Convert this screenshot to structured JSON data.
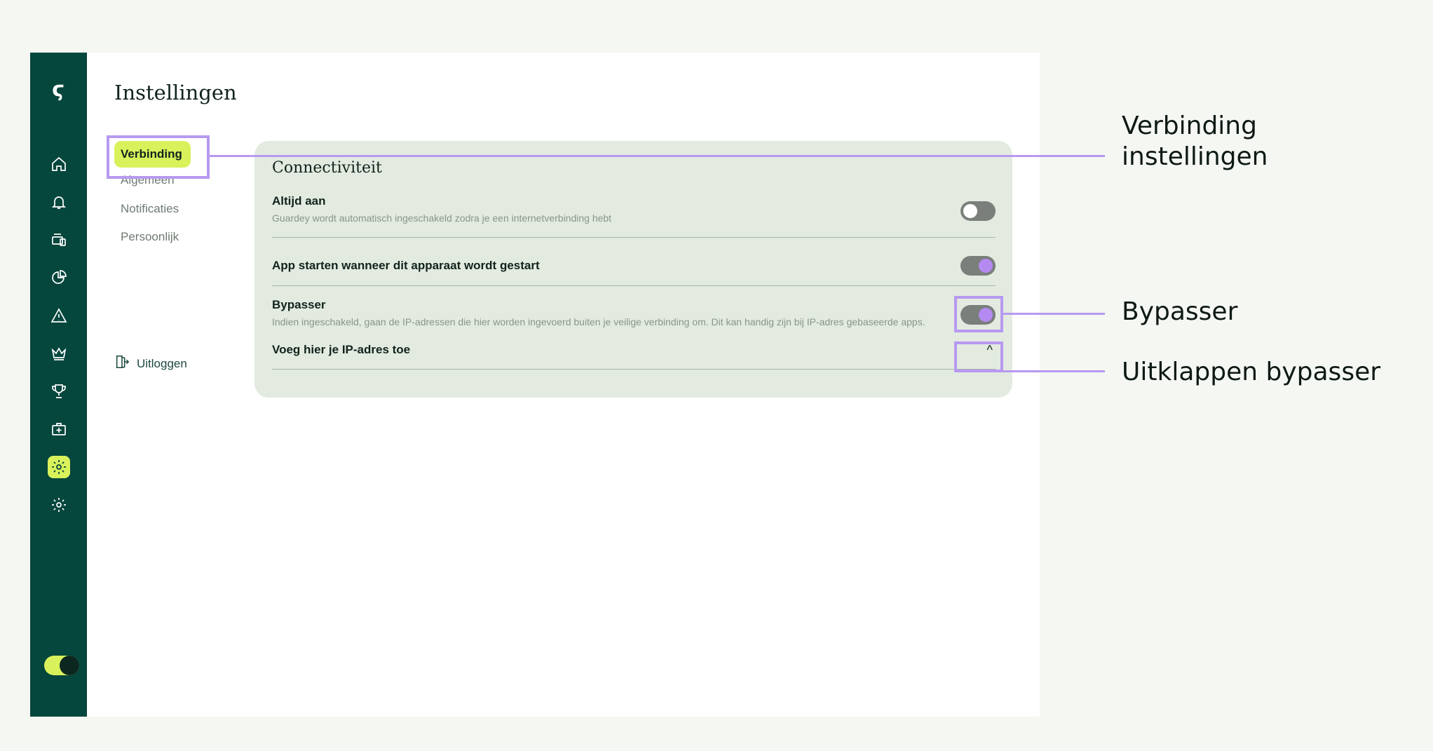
{
  "app": {
    "logo_glyph": "ϛ",
    "rail": [
      {
        "name": "home-icon"
      },
      {
        "name": "bell-icon"
      },
      {
        "name": "devices-icon"
      },
      {
        "name": "pie-chart-icon"
      },
      {
        "name": "warning-icon"
      },
      {
        "name": "crown-icon"
      },
      {
        "name": "trophy-icon"
      },
      {
        "name": "first-aid-icon"
      },
      {
        "name": "settings-icon",
        "active": true
      },
      {
        "name": "settings-alt-icon"
      }
    ],
    "accent": "#d9f25b",
    "rail_color": "#05463d"
  },
  "page": {
    "title": "Instellingen",
    "subnav": [
      "Verbinding",
      "Algemeen",
      "Notificaties",
      "Persoonlijk"
    ],
    "logout": "Uitloggen"
  },
  "panel": {
    "title": "Connectiviteit",
    "always_on": {
      "label": "Altijd aan",
      "desc": "Guardey wordt automatisch ingeschakeld zodra je een internetverbinding hebt",
      "enabled": false
    },
    "autostart": {
      "label": "App starten wanneer dit apparaat wordt gestart",
      "enabled": true
    },
    "bypasser": {
      "label": "Bypasser",
      "desc": "Indien ingeschakeld, gaan de IP-adressen die hier worden ingevoerd buiten je veilige verbinding om. Dit kan handig zijn bij IP-adres gebaseerde apps.",
      "enabled": true
    },
    "ip_add": {
      "label": "Voeg hier je IP-adres toe",
      "chevron": "^"
    }
  },
  "callouts": {
    "connection_settings": "Verbinding\ninstellingen",
    "bypasser": "Bypasser",
    "expand_bypasser": "Uitklappen bypasser",
    "color": "#b799f0"
  }
}
